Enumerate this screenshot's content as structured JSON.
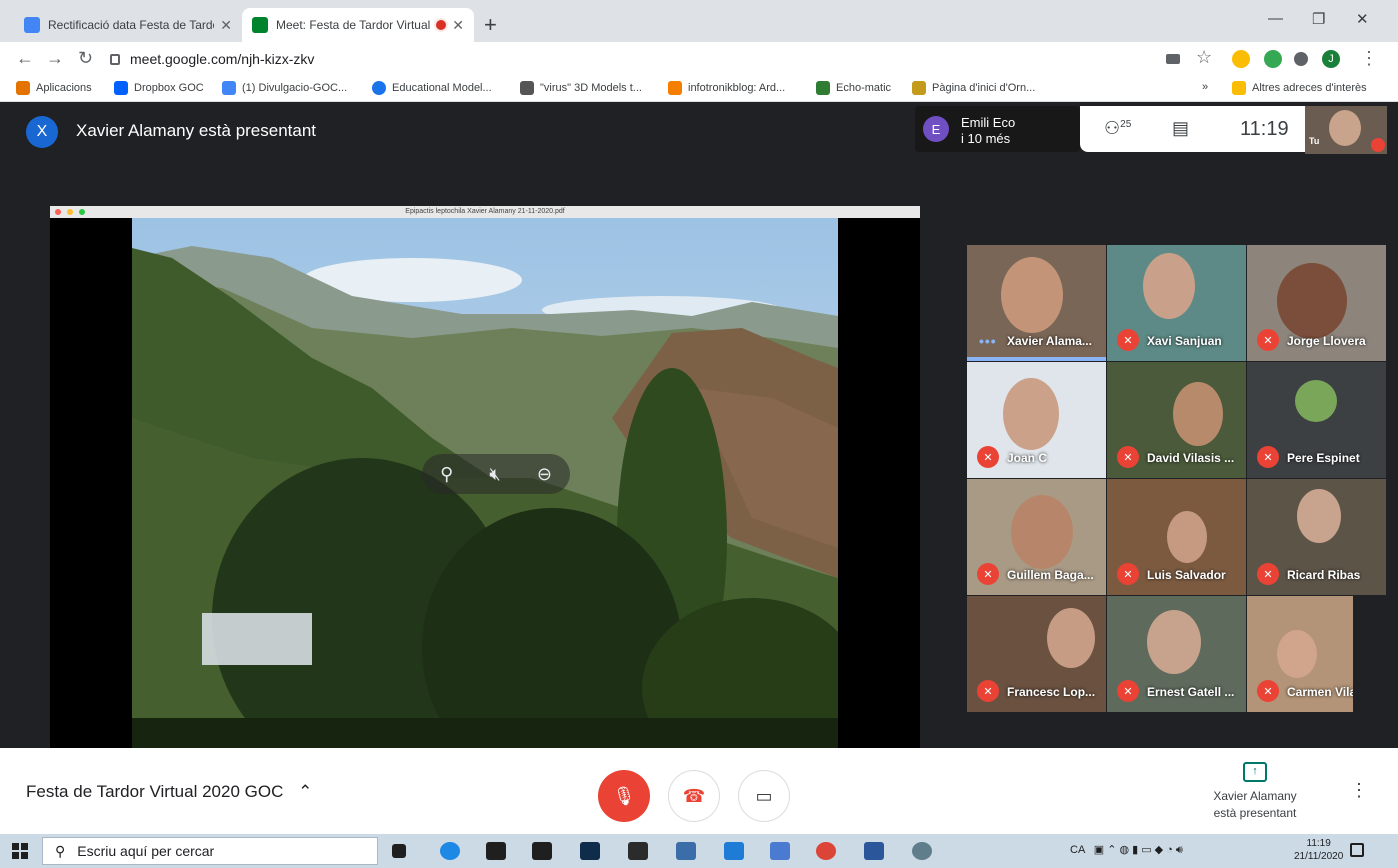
{
  "browser": {
    "tabs": [
      {
        "title": "Rectificació data Festa de Tardor",
        "close": "✕"
      },
      {
        "title": "Meet: Festa de Tardor Virtual",
        "close": "✕"
      }
    ],
    "new_tab": "+",
    "url": "meet.google.com/njh-kizx-zkv",
    "bookmarks": [
      "Aplicacions",
      "Dropbox GOC",
      "(1) Divulgacio-GOC...",
      "Educational Model...",
      "\"virus\" 3D Models t...",
      "infotronikblog: Ard...",
      "Echo-matic",
      "Pàgina d'inici d'Orn..."
    ],
    "bookmarks_overflow": "»",
    "other_bookmarks": "Altres adreces d'interès",
    "profile_initial": "J"
  },
  "meet": {
    "presenter_initial": "X",
    "presenter_banner": "Xavier Alamany està presentant",
    "top_card": {
      "initial": "E",
      "name": "Emili Eco",
      "more": "i 10 més"
    },
    "participant_count": "25",
    "clock": "11:19",
    "self_label": "Tu",
    "shared_file": "Epipactis leptochila Xavier Alamany 21-11-2020.pdf",
    "participants": [
      {
        "name": "Xavier Alama...",
        "speaking": true
      },
      {
        "name": "Xavi Sanjuan",
        "speaking": false
      },
      {
        "name": "Jorge Llovera",
        "speaking": false
      },
      {
        "name": "Joan C",
        "speaking": false
      },
      {
        "name": "David Vilasis ...",
        "speaking": false
      },
      {
        "name": "Pere Espinet",
        "speaking": false
      },
      {
        "name": "Guillem Baga...",
        "speaking": false
      },
      {
        "name": "Luis Salvador",
        "speaking": false
      },
      {
        "name": "Ricard Ribas",
        "speaking": false
      },
      {
        "name": "Francesc Lop...",
        "speaking": false
      },
      {
        "name": "Ernest Gatell ...",
        "speaking": false
      },
      {
        "name": "Carmen Vilar...",
        "speaking": false
      }
    ],
    "meeting_name": "Festa de Tardor Virtual 2020 GOC",
    "presenting_line1": "Xavier Alamany",
    "presenting_line2": "està presentant"
  },
  "taskbar": {
    "search_placeholder": "Escriu aquí per cercar",
    "lang": "CA",
    "time": "11:19",
    "date": "21/11/2020"
  },
  "colors": {
    "meet_bg": "#202124",
    "mic_off_red": "#ea4335",
    "speaking_blue": "#8ab4f8"
  }
}
